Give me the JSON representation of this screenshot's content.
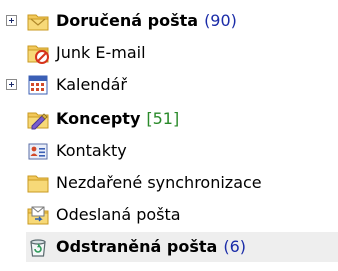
{
  "folders": [
    {
      "label": "Doručená pošta",
      "count": "(90)",
      "bold": true,
      "count_color": "#1b2ca8",
      "icon": "inbox-icon"
    },
    {
      "label": "Junk E-mail",
      "count": "",
      "bold": false,
      "icon": "junk-mail-icon"
    },
    {
      "label": "Kalendář",
      "count": "",
      "bold": false,
      "icon": "calendar-icon"
    },
    {
      "label": "Koncepty",
      "count": "[51]",
      "bold": true,
      "count_color": "#2a8a2a",
      "icon": "drafts-icon"
    },
    {
      "label": "Kontakty",
      "count": "",
      "bold": false,
      "icon": "contacts-icon"
    },
    {
      "label": "Nezdařené synchronizace",
      "count": "",
      "bold": false,
      "icon": "folder-icon"
    },
    {
      "label": "Odeslaná pošta",
      "count": "",
      "bold": false,
      "icon": "sent-mail-icon"
    },
    {
      "label": "Odstraněná pošta",
      "count": "(6)",
      "bold": true,
      "count_color": "#1b2ca8",
      "icon": "deleted-items-icon"
    }
  ],
  "colors": {
    "unread_count": "#1b2ca8",
    "drafts_count": "#2a8a2a",
    "selected_row": "#eeeeee"
  }
}
